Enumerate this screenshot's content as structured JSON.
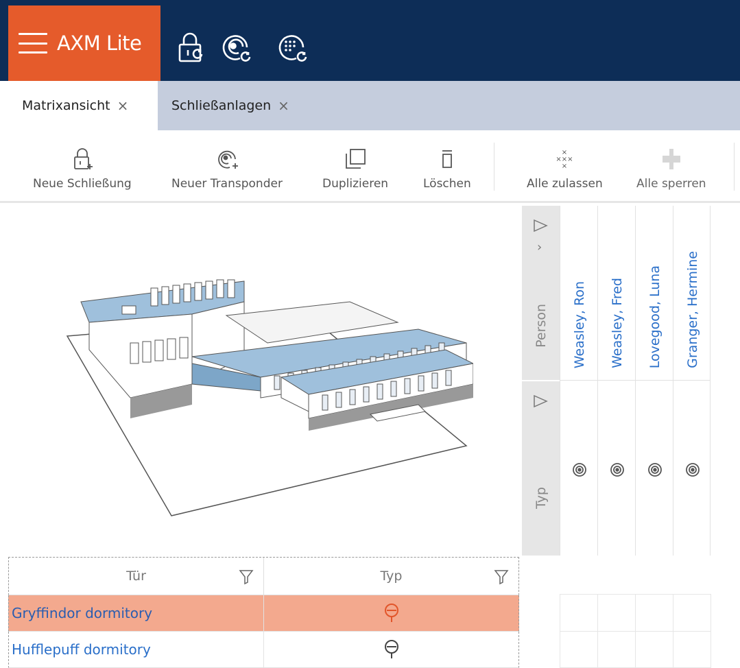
{
  "app": {
    "title": "AXM Lite"
  },
  "title_icons": [
    "lock-sync-icon",
    "transponder-sync-icon",
    "pin-keypad-sync-icon"
  ],
  "tabs": [
    {
      "label": "Matrixansicht",
      "close": "×",
      "active": true
    },
    {
      "label": "Schließanlagen",
      "close": "×",
      "active": false
    }
  ],
  "toolbar": {
    "new_lock": "Neue Schließung",
    "new_transponder": "Neuer Transponder",
    "duplicate": "Duplizieren",
    "delete": "Löschen",
    "allow_all": "Alle zulassen",
    "block_all": "Alle sperren"
  },
  "matrix": {
    "person_header": "Person",
    "type_header": "Typ",
    "expand_glyph": "›",
    "persons": [
      "Weasley, Ron",
      "Weasley, Fred",
      "Lovegood, Luna",
      "Granger, Hermine"
    ]
  },
  "table": {
    "headers": {
      "door": "Tür",
      "type": "Typ"
    },
    "rows": [
      {
        "name": "Gryffindor dormitory",
        "selected": true
      },
      {
        "name": "Hufflepuff dormitory",
        "selected": false
      }
    ]
  },
  "colors": {
    "titlebar": "#0d2d57",
    "brand": "#e55b2b",
    "tabbar": "#c5cddd",
    "link": "#2a6fc9",
    "selected_row": "#f3a98e"
  }
}
